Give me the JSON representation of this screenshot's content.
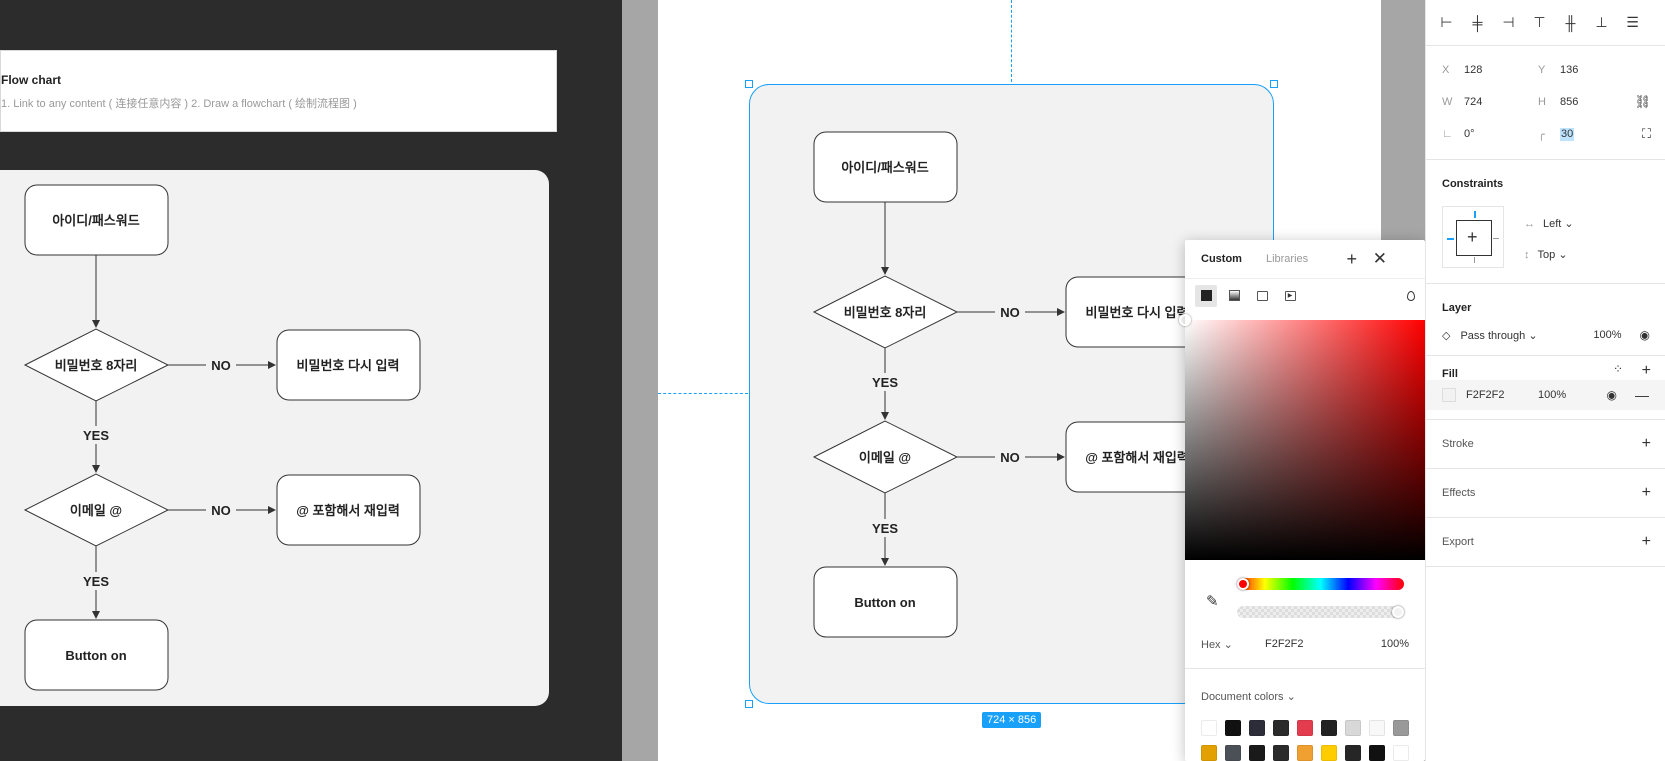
{
  "canvas": {
    "note_title": "Flow chart",
    "note_subtitle": "1. Link to any content ( 连接任意内容 ) 2. Draw a flowchart ( 绘制流程图 )",
    "size_badge": "724 × 856"
  },
  "flowchart": {
    "start": "아이디/패스워드",
    "decision1": "비밀번호 8자리",
    "decision1_no_target": "비밀번호 다시 입력",
    "decision2": "이메일 @",
    "decision2_no_target": "@ 포함해서 재입력",
    "end": "Button on",
    "label_yes": "YES",
    "label_no": "NO"
  },
  "color_picker": {
    "tab_custom": "Custom",
    "tab_libraries": "Libraries",
    "color_mode": "Hex",
    "hex_value": "F2F2F2",
    "opacity": "100%",
    "doc_colors_label": "Document colors",
    "swatches": [
      "#ffffff",
      "#111111",
      "#2d2d3a",
      "#2a2a2a",
      "#e33c4f",
      "#222222",
      "#d8d8d8",
      "#f8f8f8",
      "#999999",
      "#e2a100",
      "#4a5056",
      "#1a1a1a",
      "#2b2b2b",
      "#f0a030",
      "#ffcc00",
      "#262626",
      "#111111",
      "#ffffff"
    ]
  },
  "panel": {
    "x_label": "X",
    "x_value": "128",
    "y_label": "Y",
    "y_value": "136",
    "w_label": "W",
    "w_value": "724",
    "h_label": "H",
    "h_value": "856",
    "rotation": "0°",
    "radius": "30",
    "constraints_title": "Constraints",
    "constraint_h": "Left",
    "constraint_v": "Top",
    "layer_title": "Layer",
    "blend_mode": "Pass through",
    "layer_opacity": "100%",
    "fill_title": "Fill",
    "fill_hex": "F2F2F2",
    "fill_opacity": "100%",
    "stroke_title": "Stroke",
    "effects_title": "Effects",
    "export_title": "Export"
  },
  "colors": {
    "selection": "#18a0fb",
    "frame_fill": "#f2f2f2",
    "canvas_dark": "#2c2c2c"
  }
}
